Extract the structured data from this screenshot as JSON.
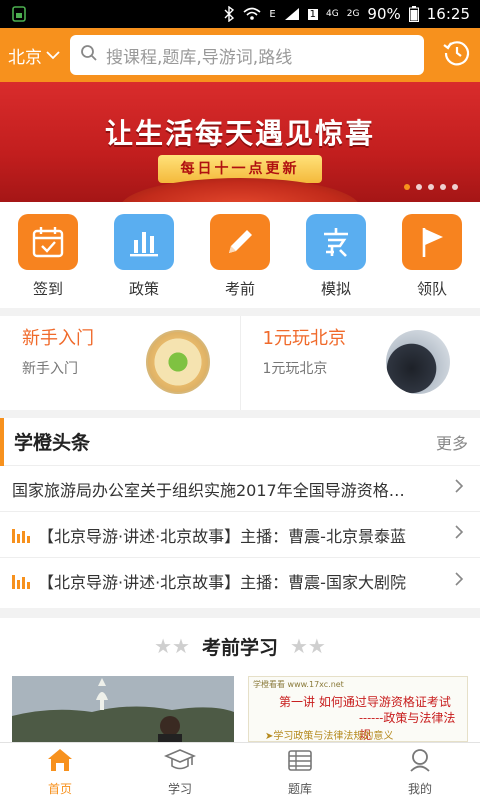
{
  "status_bar": {
    "notification_icon": "sim-icon",
    "battery": "90%",
    "time": "16:25",
    "network_a": "4G",
    "network_b": "2G",
    "badge": "E",
    "sim_slot": "1"
  },
  "header": {
    "city": "北京",
    "search_placeholder": "搜课程,题库,导游词,路线"
  },
  "banner": {
    "title": "让生活每天遇见惊喜",
    "subtitle": "每日十一点更新",
    "dots": 5,
    "active_dot": 0
  },
  "quick_entries": [
    {
      "label": "签到",
      "icon": "calendar-check-icon",
      "color": "#f7831f"
    },
    {
      "label": "政策",
      "icon": "bar-chart-icon",
      "color": "#5aaef0"
    },
    {
      "label": "考前",
      "icon": "pencil-icon",
      "color": "#f7831f"
    },
    {
      "label": "模拟",
      "icon": "exam-icon",
      "color": "#5aaef0"
    },
    {
      "label": "领队",
      "icon": "flag-icon",
      "color": "#f7831f"
    }
  ],
  "promos": [
    {
      "title": "新手入门",
      "sub": "新手入门"
    },
    {
      "title": "1元玩北京",
      "sub": "1元玩北京"
    }
  ],
  "headlines": {
    "title": "学橙头条",
    "more": "更多",
    "items": [
      {
        "text": "国家旅游局办公室关于组织实施2017年全国导游资格…",
        "audio": false
      },
      {
        "text": "【北京导游·讲述·北京故事】主播：曹震-北京景泰蓝",
        "audio": true
      },
      {
        "text": "【北京导游·讲述·北京故事】主播：曹震-国家大剧院",
        "audio": true
      }
    ]
  },
  "study": {
    "title": "考前学习",
    "thumb2_top": "学橙看看 www.17xc.net",
    "thumb2_line1": "第一讲 如何通过导游资格证考试",
    "thumb2_line2": "------政策与法律法规",
    "thumb2_line3": "➤学习政策与法律法规的意义"
  },
  "tabs": [
    {
      "label": "首页",
      "icon": "home-icon",
      "active": true
    },
    {
      "label": "学习",
      "icon": "graduation-cap-icon",
      "active": false
    },
    {
      "label": "题库",
      "icon": "books-icon",
      "active": false
    },
    {
      "label": "我的",
      "icon": "user-icon",
      "active": false
    }
  ],
  "colors": {
    "accent": "#f7911d",
    "blue": "#5aaef0",
    "promo_text": "#f06a2b"
  }
}
